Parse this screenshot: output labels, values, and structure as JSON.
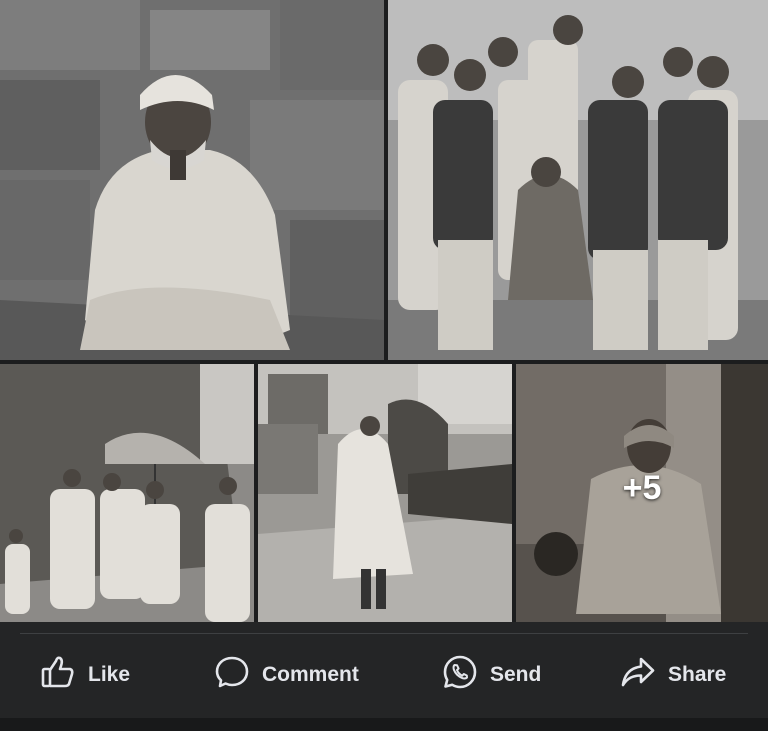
{
  "post": {
    "photos": [
      {
        "name": "seated-elder-portrait"
      },
      {
        "name": "group-standing-portrait"
      },
      {
        "name": "umbrella-procession"
      },
      {
        "name": "walking-elder-street"
      },
      {
        "name": "seated-elder-doorway"
      }
    ],
    "more_count": "+5"
  },
  "actions": {
    "like_label": "Like",
    "comment_label": "Comment",
    "send_label": "Send",
    "share_label": "Share"
  },
  "colors": {
    "background": "#242526",
    "action_text": "#e4e6eb",
    "divider": "#3e4042"
  }
}
